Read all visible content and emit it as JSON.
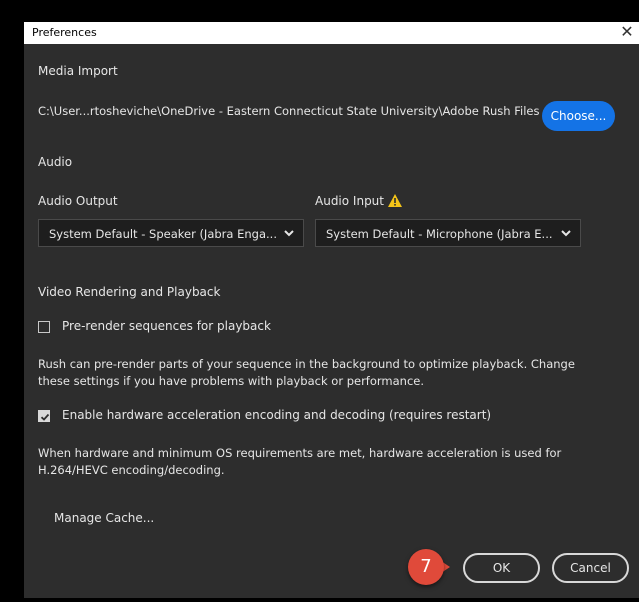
{
  "dialog": {
    "title": "Preferences"
  },
  "media_import": {
    "heading": "Media Import",
    "path": "C:\\User...rtosheviche\\OneDrive - Eastern Connecticut State University\\Adobe Rush Files",
    "choose_label": "Choose..."
  },
  "audio": {
    "heading": "Audio",
    "output_label": "Audio Output",
    "output_value": "System Default - Speaker (Jabra Enga...",
    "input_label": "Audio Input",
    "input_value": "System Default - Microphone (Jabra E...",
    "warning_icon": "warning-icon"
  },
  "video": {
    "heading": "Video Rendering and Playback",
    "prerender_label": "Pre-render sequences for playback",
    "prerender_checked": false,
    "prerender_desc_1": "Rush can pre-render parts of your sequence in the background to optimize playback. Change",
    "prerender_desc_2": "these settings if you have problems with playback or performance.",
    "hw_label": "Enable hardware acceleration encoding and decoding (requires restart)",
    "hw_checked": true,
    "hw_desc_1": "When hardware and minimum OS requirements are met, hardware acceleration is used for",
    "hw_desc_2": "H.264/HEVC encoding/decoding."
  },
  "cache": {
    "manage_label": "Manage Cache..."
  },
  "footer": {
    "ok_label": "OK",
    "cancel_label": "Cancel",
    "step_badge": "7"
  },
  "colors": {
    "accent": "#1473e6",
    "dialog_bg": "#2d2d2d",
    "badge": "#e04a3a",
    "warning": "#f5c518"
  }
}
